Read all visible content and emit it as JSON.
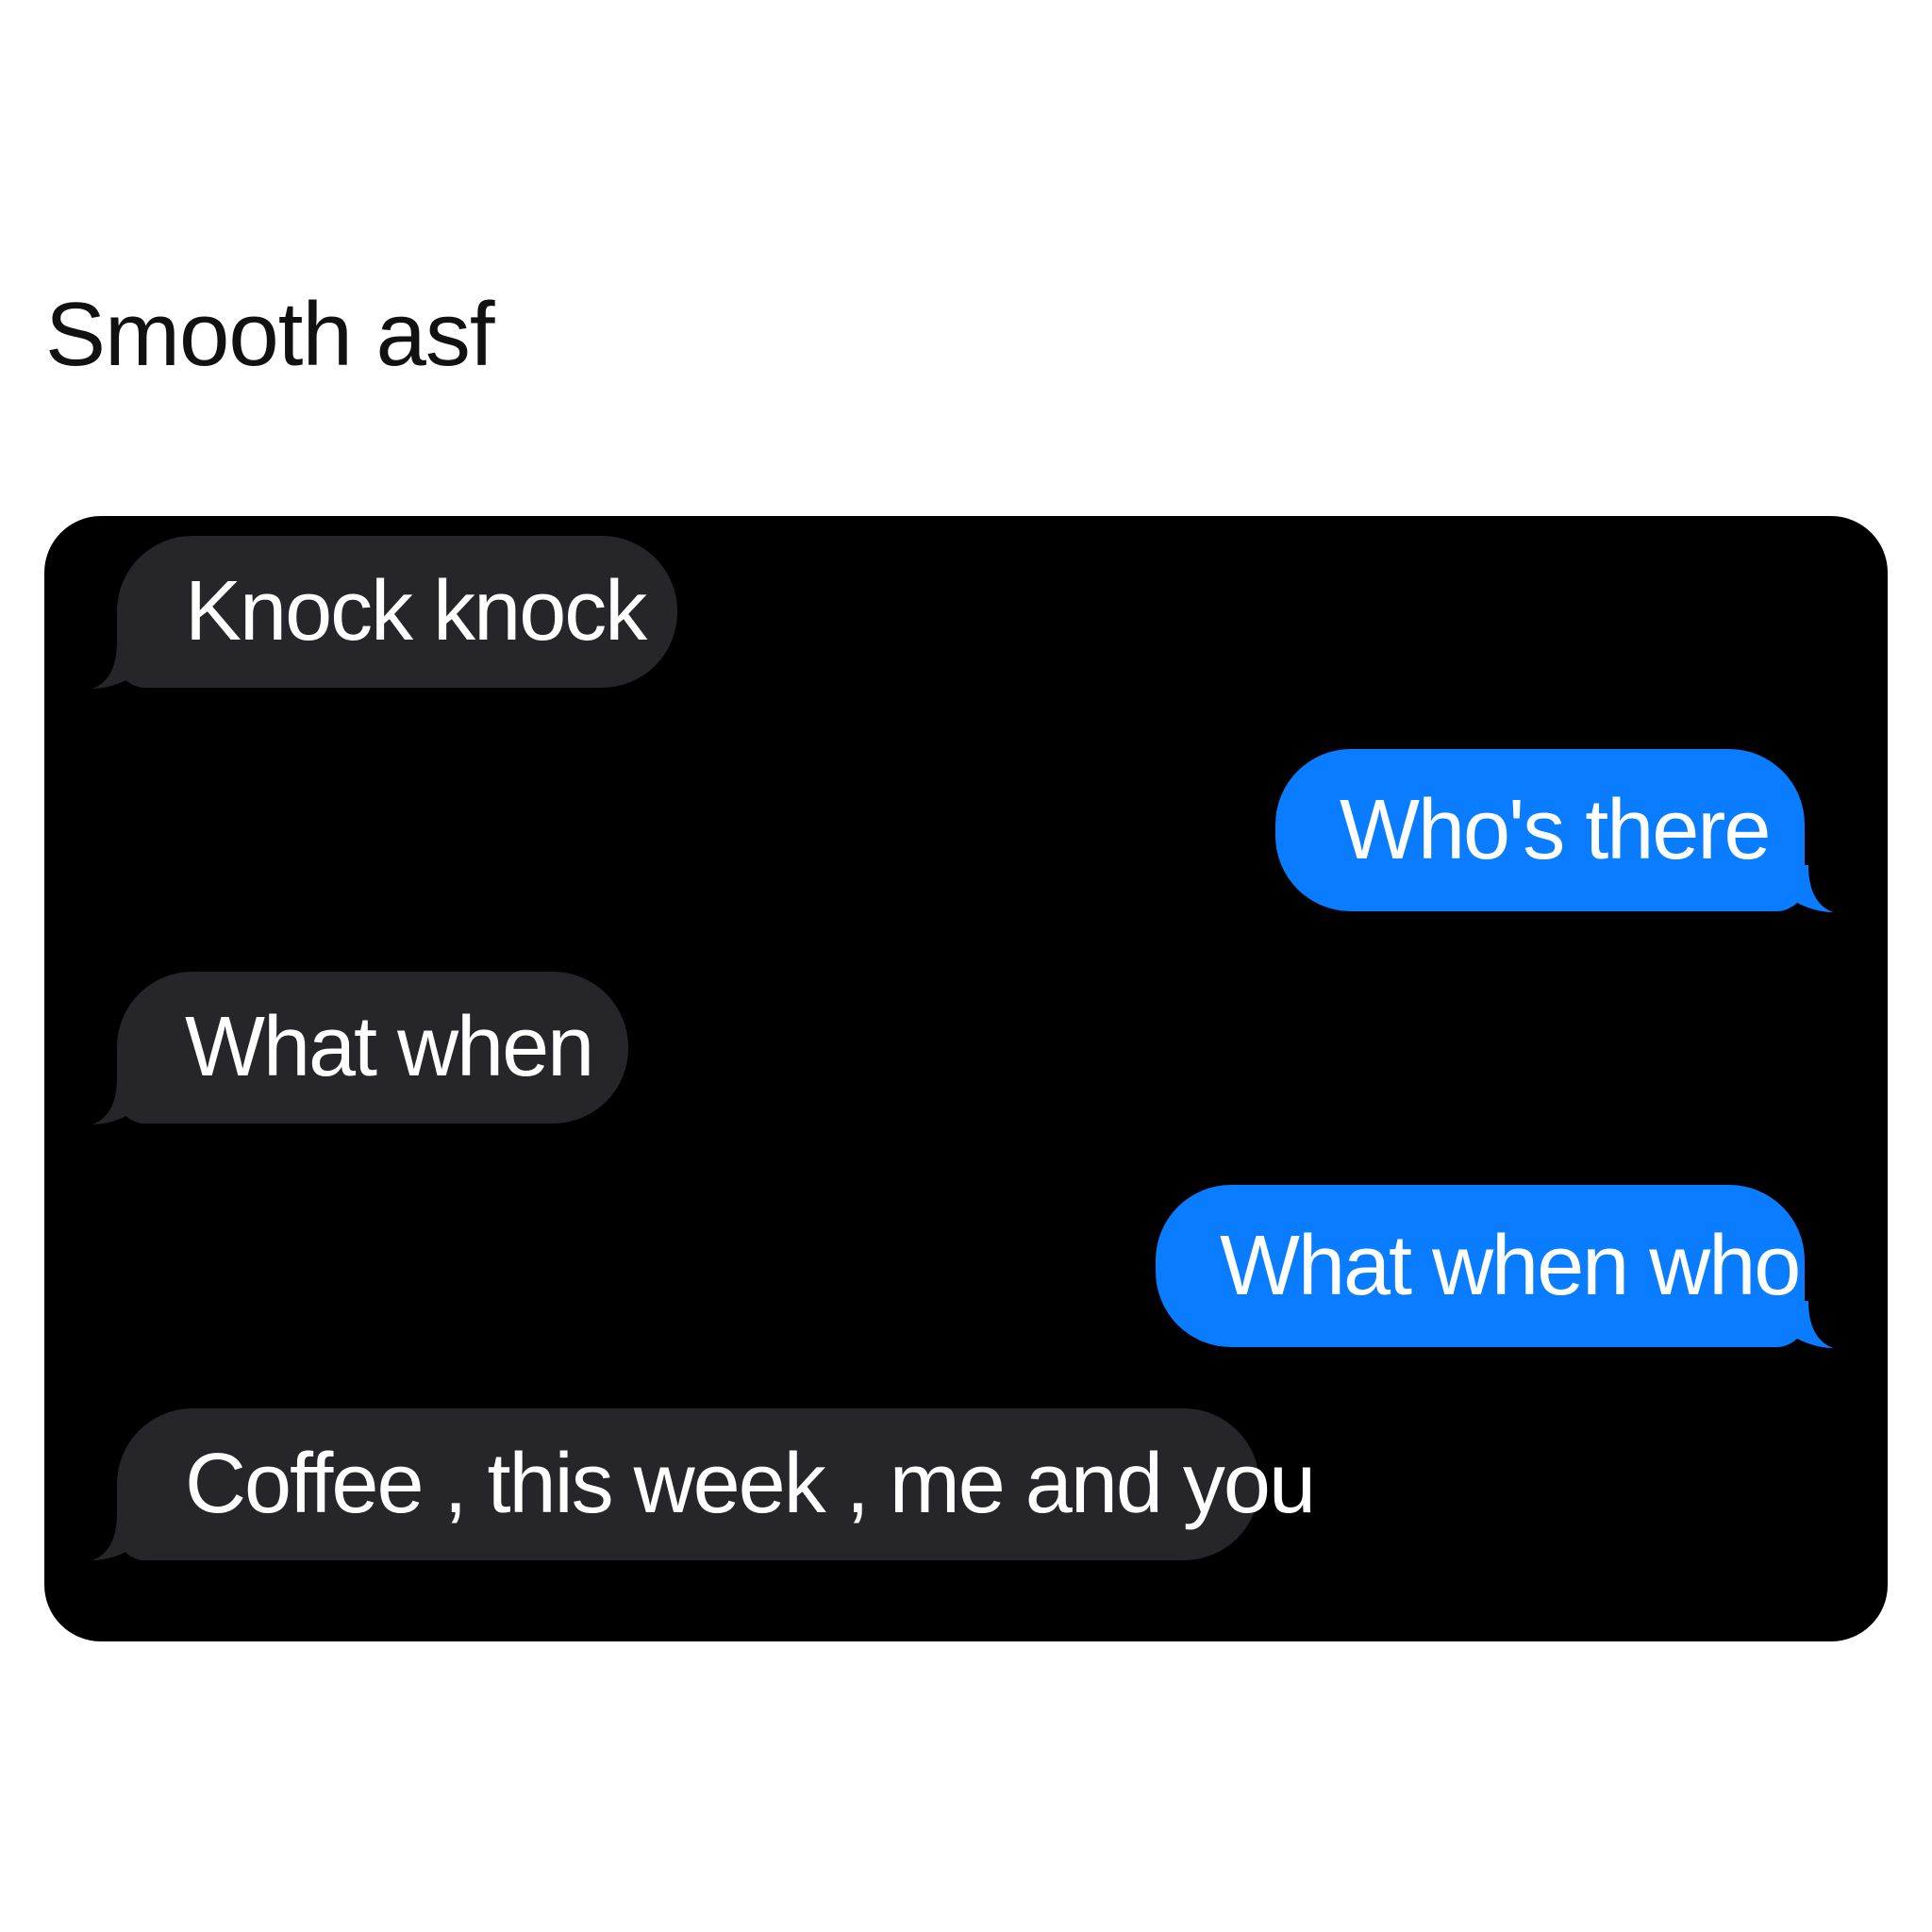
{
  "post": {
    "caption": "Smooth asf"
  },
  "conversation": {
    "messages": [
      {
        "sender": "them",
        "text": "Knock knock"
      },
      {
        "sender": "me",
        "text": "Who's there"
      },
      {
        "sender": "them",
        "text": "What when"
      },
      {
        "sender": "me",
        "text": "What when who"
      },
      {
        "sender": "them",
        "text": "Coffee , this week , me and you"
      }
    ]
  },
  "colors": {
    "incoming": "#26252a",
    "outgoing": "#0a7cff",
    "background": "#000000"
  }
}
